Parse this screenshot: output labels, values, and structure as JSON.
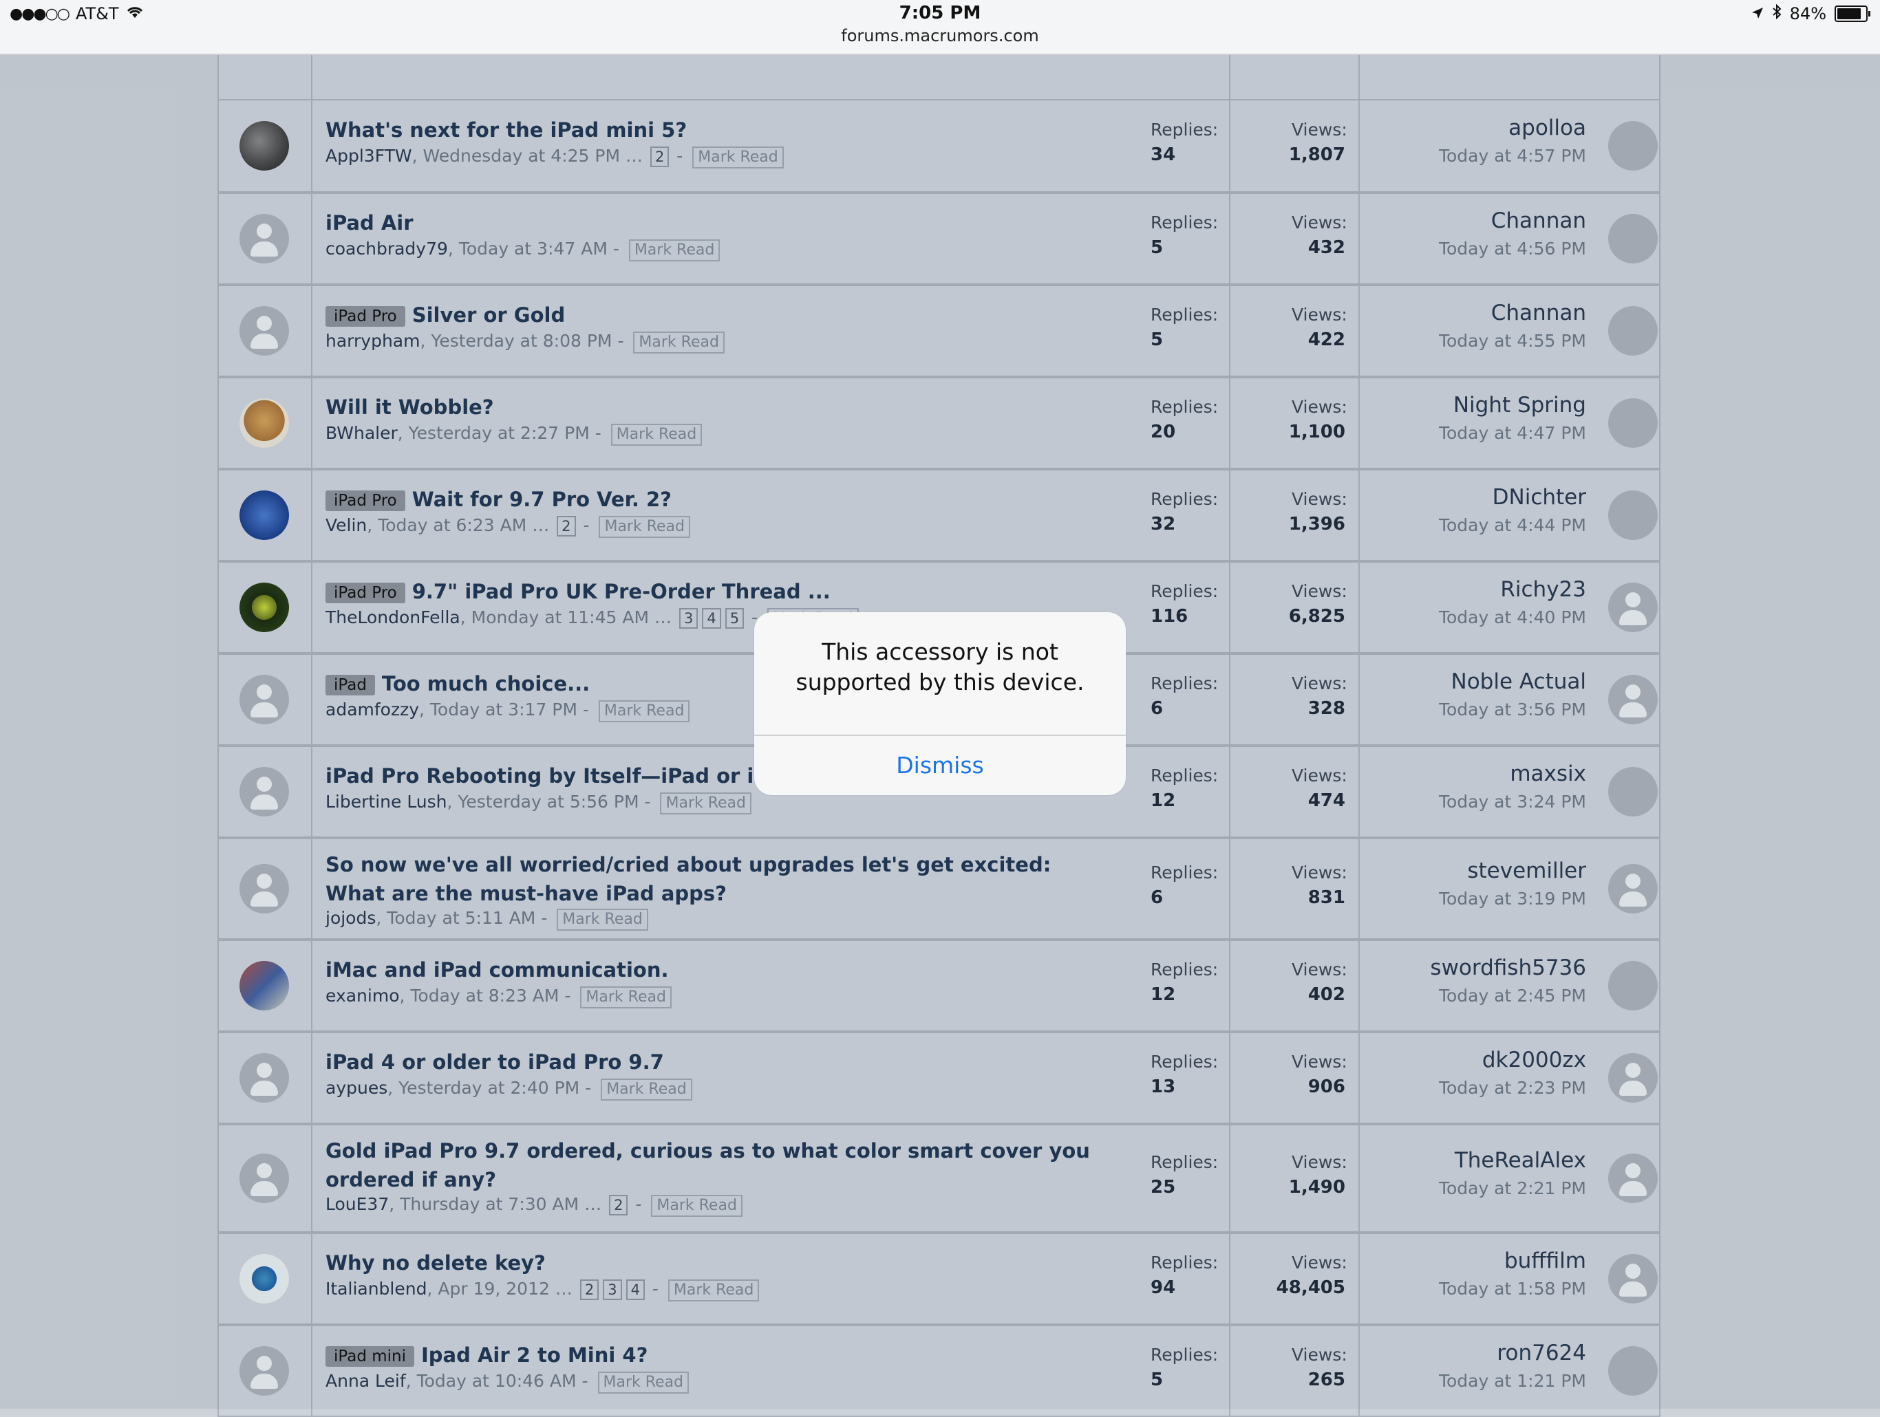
{
  "status_bar": {
    "carrier": "AT&T",
    "signal": "●●●○○",
    "time": "7:05 PM",
    "url": "forums.macrumors.com",
    "battery": "84%"
  },
  "labels": {
    "replies": "Replies:",
    "views": "Views:",
    "mark_read": "Mark Read"
  },
  "threads": [
    {
      "title": "What's next for the iPad mini 5?",
      "prefix": "",
      "author": "Appl3FTW",
      "date": "Wednesday at 4:25 PM",
      "pages": [
        "2"
      ],
      "replies": "34",
      "views": "1,807",
      "last_user": "apolloa",
      "last_time": "Today at 4:57 PM"
    },
    {
      "title": "iPad Air",
      "prefix": "",
      "author": "coachbrady79",
      "date": "Today at 3:47 AM",
      "pages": [],
      "replies": "5",
      "views": "432",
      "last_user": "Channan",
      "last_time": "Today at 4:56 PM"
    },
    {
      "title": "Silver or Gold",
      "prefix": "iPad Pro",
      "author": "harrypham",
      "date": "Yesterday at 8:08 PM",
      "pages": [],
      "replies": "5",
      "views": "422",
      "last_user": "Channan",
      "last_time": "Today at 4:55 PM"
    },
    {
      "title": "Will it Wobble?",
      "prefix": "",
      "author": "BWhaler",
      "date": "Yesterday at 2:27 PM",
      "pages": [],
      "replies": "20",
      "views": "1,100",
      "last_user": "Night Spring",
      "last_time": "Today at 4:47 PM"
    },
    {
      "title": "Wait for 9.7 Pro Ver. 2?",
      "prefix": "iPad Pro",
      "author": "Velin",
      "date": "Today at 6:23 AM",
      "pages": [
        "2"
      ],
      "replies": "32",
      "views": "1,396",
      "last_user": "DNichter",
      "last_time": "Today at 4:44 PM"
    },
    {
      "title": "9.7\" iPad Pro UK Pre-Order Thread ...",
      "prefix": "iPad Pro",
      "author": "TheLondonFella",
      "date": "Monday at 11:45 AM",
      "pages": [
        "3",
        "4",
        "5"
      ],
      "replies": "116",
      "views": "6,825",
      "last_user": "Richy23",
      "last_time": "Today at 4:40 PM"
    },
    {
      "title": "Too much choice...",
      "prefix": "iPad",
      "author": "adamfozzy",
      "date": "Today at 3:17 PM",
      "pages": [],
      "replies": "6",
      "views": "328",
      "last_user": "Noble Actual",
      "last_time": "Today at 3:56 PM"
    },
    {
      "title": "iPad Pro Rebooting by Itself—iPad or iO",
      "prefix": "",
      "author": "Libertine Lush",
      "date": "Yesterday at 5:56 PM",
      "pages": [],
      "replies": "12",
      "views": "474",
      "last_user": "maxsix",
      "last_time": "Today at 3:24 PM"
    },
    {
      "title": "So now we've all worried/cried about upgrades let's get excited: What are the must-have iPad apps?",
      "prefix": "",
      "author": "jojods",
      "date": "Today at 5:11 AM",
      "pages": [],
      "replies": "6",
      "views": "831",
      "last_user": "stevemiller",
      "last_time": "Today at 3:19 PM"
    },
    {
      "title": "iMac and iPad communication.",
      "prefix": "",
      "author": "exanimo",
      "date": "Today at 8:23 AM",
      "pages": [],
      "replies": "12",
      "views": "402",
      "last_user": "swordfish5736",
      "last_time": "Today at 2:45 PM"
    },
    {
      "title": "iPad 4 or older to iPad Pro 9.7",
      "prefix": "",
      "author": "aypues",
      "date": "Yesterday at 2:40 PM",
      "pages": [],
      "replies": "13",
      "views": "906",
      "last_user": "dk2000zx",
      "last_time": "Today at 2:23 PM"
    },
    {
      "title": "Gold iPad Pro 9.7 ordered, curious as to what color smart cover you ordered if any?",
      "prefix": "",
      "author": "LouE37",
      "date": "Thursday at 7:30 AM",
      "pages": [
        "2"
      ],
      "replies": "25",
      "views": "1,490",
      "last_user": "TheRealAlex",
      "last_time": "Today at 2:21 PM"
    },
    {
      "title": "Why no delete key?",
      "prefix": "",
      "author": "Italianblend",
      "date": "Apr 19, 2012",
      "pages": [
        "2",
        "3",
        "4"
      ],
      "replies": "94",
      "views": "48,405",
      "last_user": "bufffilm",
      "last_time": "Today at 1:58 PM"
    },
    {
      "title": "Ipad Air 2 to Mini 4?",
      "prefix": "iPad mini",
      "author": "Anna Leif",
      "date": "Today at 10:46 AM",
      "pages": [],
      "replies": "5",
      "views": "265",
      "last_user": "ron7624",
      "last_time": "Today at 1:21 PM"
    }
  ],
  "alert": {
    "message_line1": "This accessory is not",
    "message_line2": "supported by this device.",
    "dismiss_label": "Dismiss"
  }
}
